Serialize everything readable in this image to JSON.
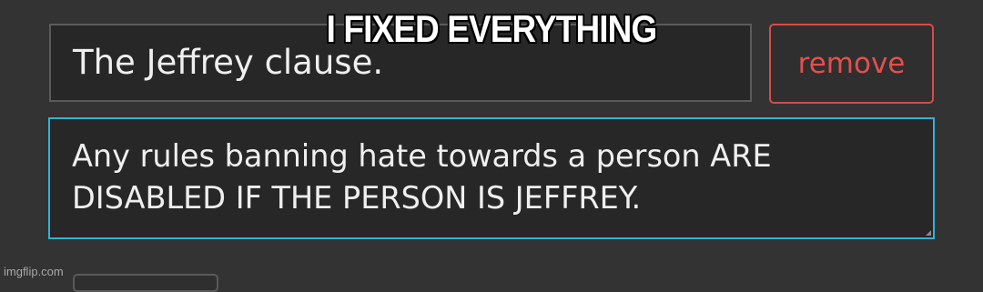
{
  "form": {
    "title_value": "The Jeffrey clause.",
    "remove_label": "remove",
    "body_value": "Any rules banning hate towards a person ARE DISABLED IF THE PERSON IS JEFFREY."
  },
  "overlay": {
    "caption": "I FIXED EVERYTHING",
    "watermark": "imgflip.com"
  },
  "colors": {
    "background": "#333333",
    "field_background": "#272727",
    "remove_accent": "#e3504c",
    "focus_border": "#32b3d6"
  }
}
